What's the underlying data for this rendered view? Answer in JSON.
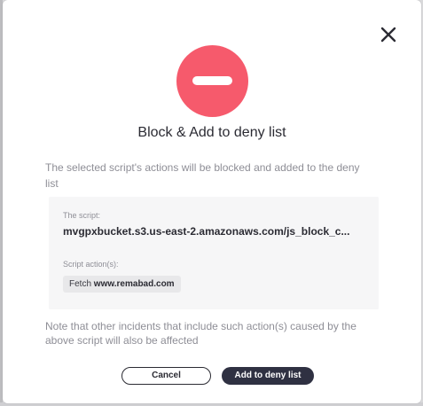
{
  "colors": {
    "hero_circle": "#f65a6c",
    "primary_button": "#2f3142",
    "muted_text": "#8e8e96"
  },
  "dialog": {
    "close_icon": "close-icon",
    "hero_icon": "minus-circle-icon",
    "title": "Block & Add to deny list",
    "description": "The selected script's actions will be blocked and added to the deny list",
    "script_label": "The script:",
    "script_value": "mvgpxbucket.s3.us-east-2.amazonaws.com/js_block_c...",
    "actions_label": "Script action(s):",
    "action": {
      "method": "Fetch",
      "domain": "www.remabad.com"
    },
    "note": "Note that other incidents that include such action(s) caused by the above script will also be affected",
    "cancel_label": "Cancel",
    "confirm_label": "Add to deny list"
  }
}
